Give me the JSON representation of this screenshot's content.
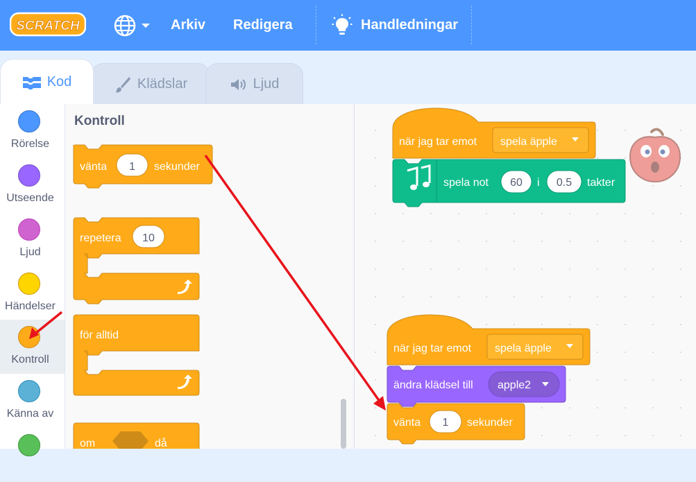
{
  "menubar": {
    "logo_text": "SCRATCH",
    "items": [
      "Arkiv",
      "Redigera",
      "Handledningar"
    ],
    "icons": [
      "globe-icon",
      "lightbulb-icon"
    ]
  },
  "tabs": [
    {
      "label": "Kod",
      "icon": "code-icon",
      "active": true
    },
    {
      "label": "Klädslar",
      "icon": "brush-icon",
      "active": false
    },
    {
      "label": "Ljud",
      "icon": "speaker-icon",
      "active": false
    }
  ],
  "categories": [
    {
      "label": "Rörelse",
      "color": "#4c97ff",
      "border": "#3373cc"
    },
    {
      "label": "Utseende",
      "color": "#9966ff",
      "border": "#774dcb"
    },
    {
      "label": "Ljud",
      "color": "#cf63cf",
      "border": "#bd42bd"
    },
    {
      "label": "Händelser",
      "color": "#ffd500",
      "border": "#cc9900"
    },
    {
      "label": "Kontroll",
      "color": "#ffab19",
      "border": "#cf8b17",
      "selected": true
    },
    {
      "label": "Känna av",
      "color": "#5cb1d6",
      "border": "#2e8eb8"
    },
    {
      "label": "",
      "color": "#59c059",
      "border": "#389438"
    }
  ],
  "palette": {
    "title": "Kontroll",
    "wait": {
      "label1": "vänta",
      "value": "1",
      "label2": "sekunder"
    },
    "repeat": {
      "label": "repetera",
      "value": "10"
    },
    "forever": {
      "label": "för alltid"
    },
    "if": {
      "label1": "om",
      "label2": "då"
    }
  },
  "script1": {
    "hat": {
      "label": "när jag tar emot",
      "dropdown": "spela äpple"
    },
    "note": {
      "label1": "spela not",
      "note": "60",
      "label2": "i",
      "beats": "0.5",
      "label3": "takter"
    }
  },
  "script2": {
    "hat": {
      "label": "när jag tar emot",
      "dropdown": "spela äpple"
    },
    "costume": {
      "label": "ändra klädsel till",
      "dropdown": "apple2"
    },
    "wait": {
      "label1": "vänta",
      "value": "1",
      "label2": "sekunder"
    }
  },
  "colors": {
    "menubar": "#4c97ff",
    "control": "#ffab19",
    "control_border": "#cf8b17",
    "looks": "#9966ff",
    "music": "#0fbd8c",
    "annotation_arrow": "#e8141c"
  }
}
